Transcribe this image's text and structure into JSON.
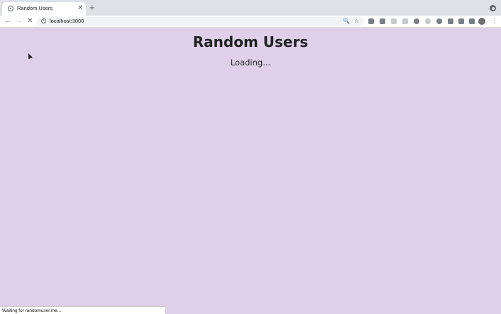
{
  "browser": {
    "tab": {
      "title": "Random Users",
      "favicon": "react-icon",
      "close_glyph": "✕"
    },
    "new_tab_glyph": "+",
    "toolbar": {
      "back_glyph": "←",
      "forward_glyph": "→",
      "stop_glyph": "✕",
      "url": "localhost:3000",
      "zoom_glyph": "🔍",
      "star_glyph": "☆",
      "menu_glyph": "⋮"
    },
    "status_text": "Waiting for randomuser.me..."
  },
  "page": {
    "title": "Random Users",
    "loading": "Loading...",
    "background": "#dfcfe9"
  }
}
